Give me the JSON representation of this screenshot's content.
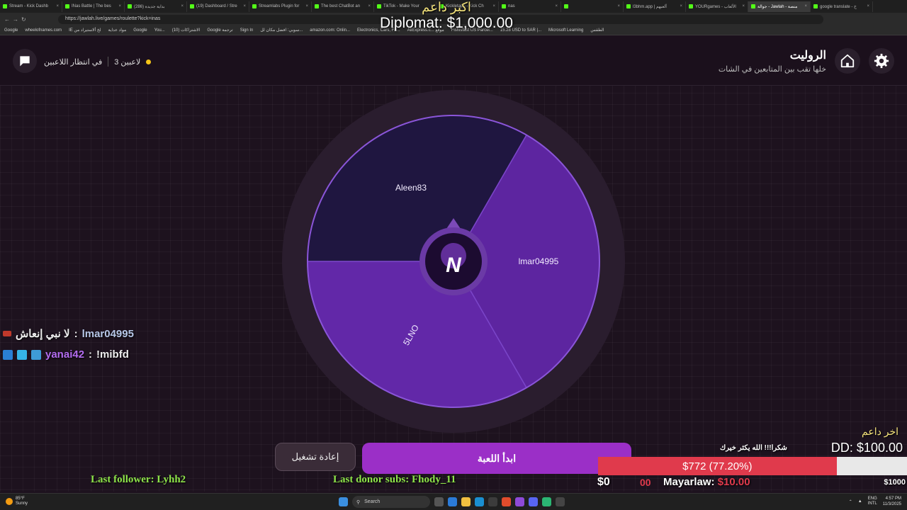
{
  "browser": {
    "tabs": [
      {
        "label": "Stream - Kick Dashb"
      },
      {
        "label": "INas Battle | The bes"
      },
      {
        "label": "(286) بداية جديدة"
      },
      {
        "label": "(19) Dashboard / Stre"
      },
      {
        "label": "Streamlabs Plugin for"
      },
      {
        "label": "The best ChatBot an"
      },
      {
        "label": "TikTok - Make Your"
      },
      {
        "label": "Kickletapp - Kick Ch"
      },
      {
        "label": "nas"
      },
      {
        "label": ""
      },
      {
        "label": "l3bhm.app | ألعبهم"
      },
      {
        "label": "YOURgames - الألعاب"
      },
      {
        "label": "جوالة - Jawlah - منصة"
      },
      {
        "label": "google translate - خ"
      }
    ],
    "url": "https://jawlah.live/games/roulette?kick=inas",
    "bookmarks": [
      "Google",
      "wheelofnames.com",
      "IE لخ ألاستيراد من",
      "مواد عداية",
      "Google",
      "You...",
      "(10) الاشتراكات",
      "Google ترجمة",
      "Sign In",
      "سوبي: افضل مكان لل...",
      "amazon.com: Onlin...",
      "Electronics, Cars, Fa...",
      "AliExpress.c... موقع",
      "Fishisfast US Parcel...",
      "15.28 USD to SAR |...",
      "Microsoft Learning",
      "الطقس"
    ]
  },
  "header": {
    "title": "الروليت",
    "subtitle": "خلها تقب بين المتابعين في الشات",
    "players_count": "3 لاعبين",
    "waiting": "في انتظار اللاعبين"
  },
  "wheel": {
    "segments": [
      {
        "label": "lmar04995",
        "color": "#5d25a0"
      },
      {
        "label": "5LNO",
        "color": "#6228a8"
      },
      {
        "label": "Aleen83",
        "color": "#1f1640"
      }
    ],
    "center_logo": "N"
  },
  "buttons": {
    "start": "ابدأ اللعبة",
    "restart": "إعادة تشغيل"
  },
  "overlay": {
    "top_donor_label": "اكبر داعم",
    "top_donor_value": "Diplomat: $1,000.00",
    "chat": [
      {
        "user": "lmar04995",
        "sep": ":",
        "message": "لا نبي إنعاش",
        "color": "#b7c7e8"
      },
      {
        "user": "yanai42",
        "sep": ":",
        "message": "!mibfd",
        "color": "#b36cf0"
      }
    ],
    "last_follower": "Last follower: Lyhh2",
    "last_sub": "Last donor subs: Fhody_11",
    "last_donor_label": "اخر داعم",
    "last_donor_value": "DD: $100.00",
    "thanks": "شكرا!!! الله يكثر خيرك",
    "goal_text": "$772 (77.20%)",
    "goal_fraction": 0.772,
    "goal_min": "$0",
    "goal_zero": "00",
    "goal_max": "$1000",
    "latest_donation_name": "Mayarlaw:",
    "latest_donation_amount": "$10.00"
  },
  "taskbar": {
    "weather_temp": "85°F",
    "weather_desc": "Sunny",
    "search": "Search",
    "lang": "ENG",
    "lang2": "INTL",
    "time": "4:57 PM",
    "date": "11/3/2025"
  },
  "colors": {
    "accent": "#9b2fc7",
    "background": "#1d121e",
    "goal_red": "#e03a4c",
    "highlight_green": "#8ee44a"
  }
}
